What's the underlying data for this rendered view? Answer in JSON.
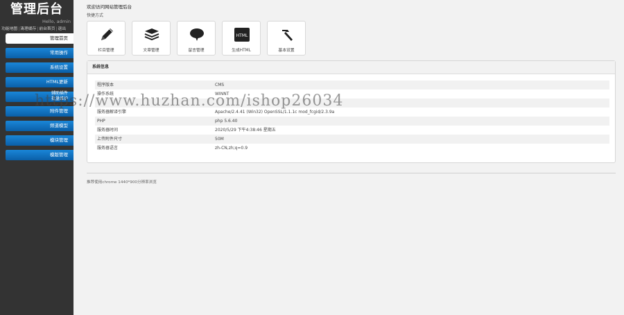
{
  "sidebar": {
    "title": "管理后台",
    "greeting": "Hello, admin",
    "top_links": [
      "功能地图",
      "清理缓存",
      "前台首页",
      "退出"
    ],
    "menu": [
      {
        "label": "管理首页",
        "active": true
      },
      {
        "label": "常用操作"
      },
      {
        "label": "系统设置"
      },
      {
        "label": "HTML更新"
      },
      {
        "label": "辅助插件",
        "label2": "批量维护"
      },
      {
        "label": "附件管理"
      },
      {
        "label": "频道模型"
      },
      {
        "label": "模块管理"
      },
      {
        "label": "模版管理"
      }
    ]
  },
  "main": {
    "welcome": "欢迎访问网站管理后台",
    "shortcut_title": "快捷方式",
    "shortcuts": [
      {
        "label": "栏目管理",
        "icon": "pencil-icon"
      },
      {
        "label": "文章管理",
        "icon": "stack-icon"
      },
      {
        "label": "留言管理",
        "icon": "speech-bubble-icon"
      },
      {
        "label": "生成HTML",
        "icon": "html-icon",
        "badge": "HTML"
      },
      {
        "label": "基本设置",
        "icon": "hammer-icon"
      }
    ],
    "panel_title": "系统信息",
    "info": [
      {
        "key": "程序版本",
        "value": "CMS"
      },
      {
        "key": "操作系统",
        "value": "WINNT"
      },
      {
        "key": "",
        "value": ""
      },
      {
        "key": "服务器解译引擎",
        "value": "Apache/2.4.41 (Win32) OpenSSL/1.1.1c mod_fcgid/2.3.9a"
      },
      {
        "key": "PHP",
        "value": "php 5.6.40"
      },
      {
        "key": "服务器时间",
        "value": "2020/5/29 下午4:38:46 星期五"
      },
      {
        "key": "上传附件尺寸",
        "value": "50M"
      },
      {
        "key": "服务器语言",
        "value": "zh-CN,zh;q=0.9"
      }
    ],
    "footer": "推荐使用chrome 1440*900分辨率浏览"
  },
  "watermark": "https://www.huzhan.com/ishop26034",
  "colors": {
    "sidebar_bg": "#333333",
    "menu_blue": "#0a6fc2",
    "page_bg": "#f2f2f2"
  }
}
